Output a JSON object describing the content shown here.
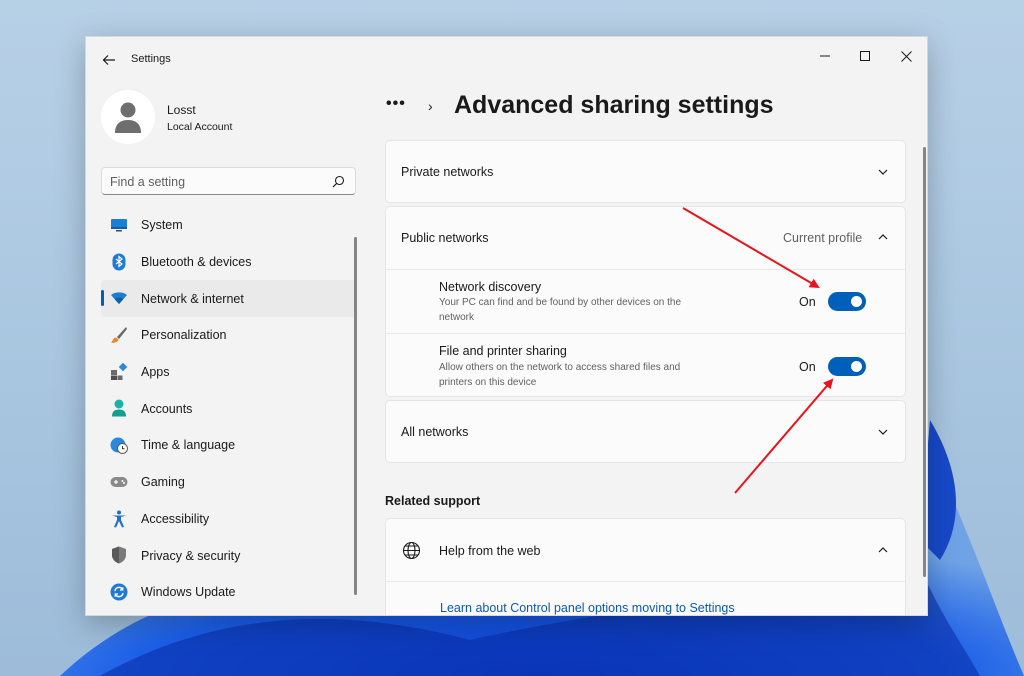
{
  "window": {
    "app_title": "Settings"
  },
  "profile": {
    "name": "Losst",
    "account_type": "Local Account"
  },
  "search": {
    "placeholder": "Find a setting"
  },
  "sidebar": {
    "items": [
      {
        "label": "System",
        "icon": "monitor-icon"
      },
      {
        "label": "Bluetooth & devices",
        "icon": "bluetooth-icon"
      },
      {
        "label": "Network & internet",
        "icon": "wifi-icon",
        "active": true
      },
      {
        "label": "Personalization",
        "icon": "brush-icon"
      },
      {
        "label": "Apps",
        "icon": "apps-icon"
      },
      {
        "label": "Accounts",
        "icon": "person-icon"
      },
      {
        "label": "Time & language",
        "icon": "globe-clock-icon"
      },
      {
        "label": "Gaming",
        "icon": "gamepad-icon"
      },
      {
        "label": "Accessibility",
        "icon": "accessibility-icon"
      },
      {
        "label": "Privacy & security",
        "icon": "shield-icon"
      },
      {
        "label": "Windows Update",
        "icon": "update-icon"
      }
    ]
  },
  "breadcrumb": {
    "dots": "•••",
    "separator": "›"
  },
  "main": {
    "title": "Advanced sharing settings",
    "private_networks": {
      "label": "Private networks"
    },
    "public_networks": {
      "label": "Public networks",
      "badge": "Current profile",
      "network_discovery": {
        "title": "Network discovery",
        "desc": "Your PC can find and be found by other devices on the network",
        "state": "On",
        "enabled": true
      },
      "file_printer_sharing": {
        "title": "File and printer sharing",
        "desc": "Allow others on the network to access shared files and printers on this device",
        "state": "On",
        "enabled": true
      }
    },
    "all_networks": {
      "label": "All networks"
    },
    "related_support": {
      "heading": "Related support",
      "help": {
        "label": "Help from the web",
        "link": "Learn about Control panel options moving to Settings"
      }
    }
  },
  "colors": {
    "accent": "#005fb8",
    "annotation_arrow": "#e8141b",
    "link": "#0a58b8"
  }
}
